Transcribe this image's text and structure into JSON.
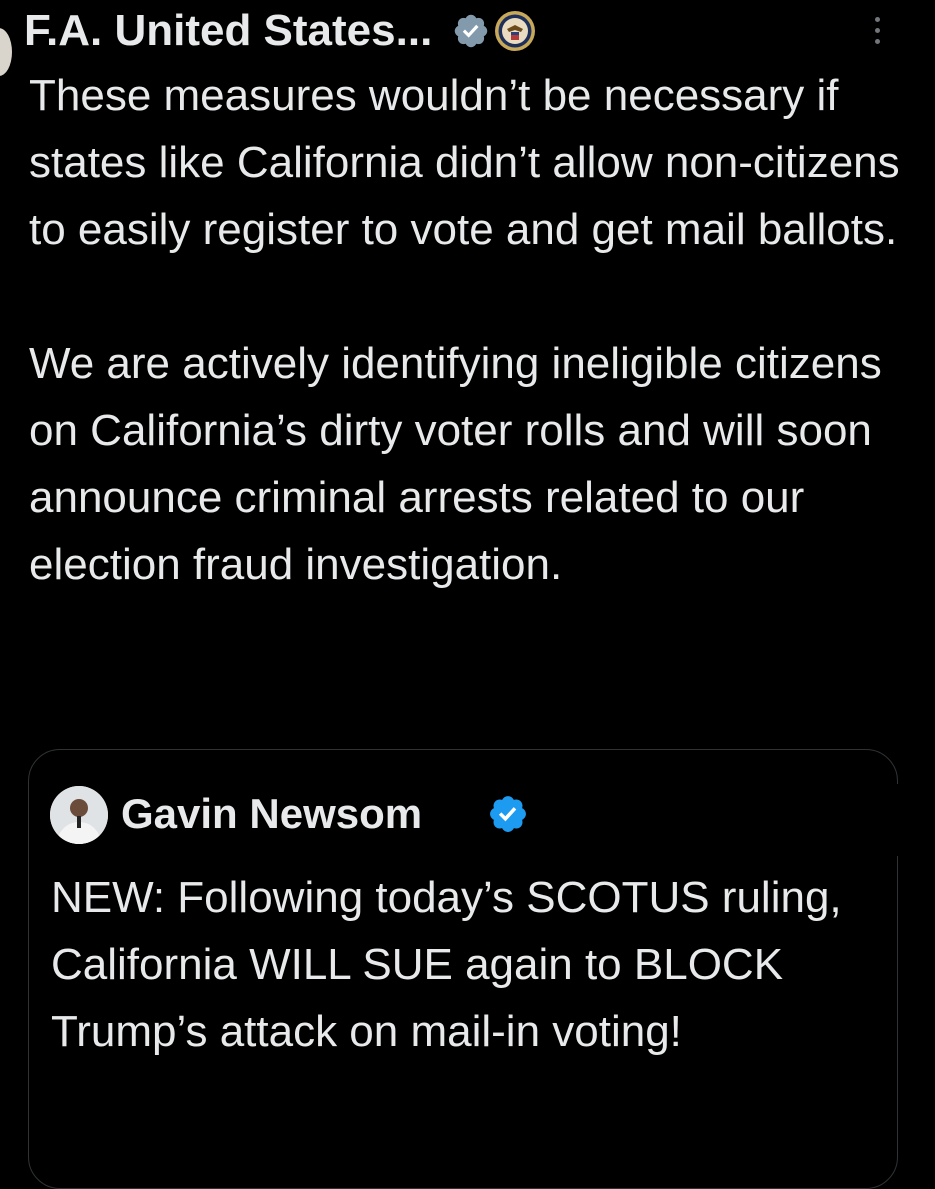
{
  "post": {
    "author_name": "F.A. United States...",
    "paragraph1": "These measures wouldn’t be necessary if states like California didn’t allow non-citizens to easily register to vote and get mail ballots.",
    "paragraph2": "We are actively identifying ineligible citizens on California’s dirty voter rolls and will soon announce criminal arrests related to our election fraud investigation."
  },
  "quoted_post": {
    "author_name": "Gavin Newsom",
    "text": "NEW: Following today’s SCOTUS ruling, California WILL SUE again to BLOCK Trump’s attack on mail-in voting!"
  },
  "icons": {
    "verified": "verified-badge-icon",
    "agency": "government-seal-icon",
    "more": "more-options-icon"
  },
  "colors": {
    "background": "#000000",
    "text": "#e7e9ea",
    "verified_gray": "#829aab",
    "verified_blue": "#1d9bf0",
    "border": "#2f3336"
  }
}
